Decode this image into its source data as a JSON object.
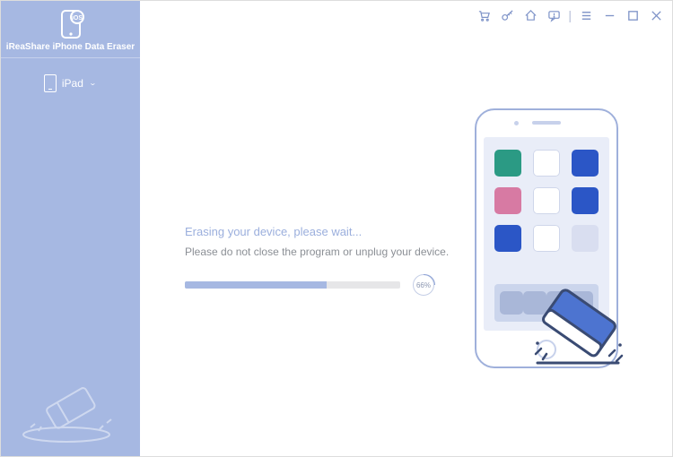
{
  "app": {
    "name": "iReaShare iPhone Data Eraser"
  },
  "sidebar": {
    "device_label": "iPad"
  },
  "titlebar": {
    "icons": [
      "cart-icon",
      "key-icon",
      "home-icon",
      "feedback-icon",
      "menu-icon",
      "minimize-icon",
      "maximize-icon",
      "close-icon"
    ]
  },
  "progress": {
    "title": "Erasing your device, please wait...",
    "subtitle": "Please do not close the program or unplug your device.",
    "percent": 66,
    "percent_label": "66%"
  },
  "illustration": {
    "app_colors": [
      "#2b9a84",
      "#ffffff",
      "#2b56c6",
      "#d77aa3",
      "#ffffff",
      "#2b56c6",
      "#2b56c6",
      "#ffffff",
      "#d9def0"
    ]
  }
}
